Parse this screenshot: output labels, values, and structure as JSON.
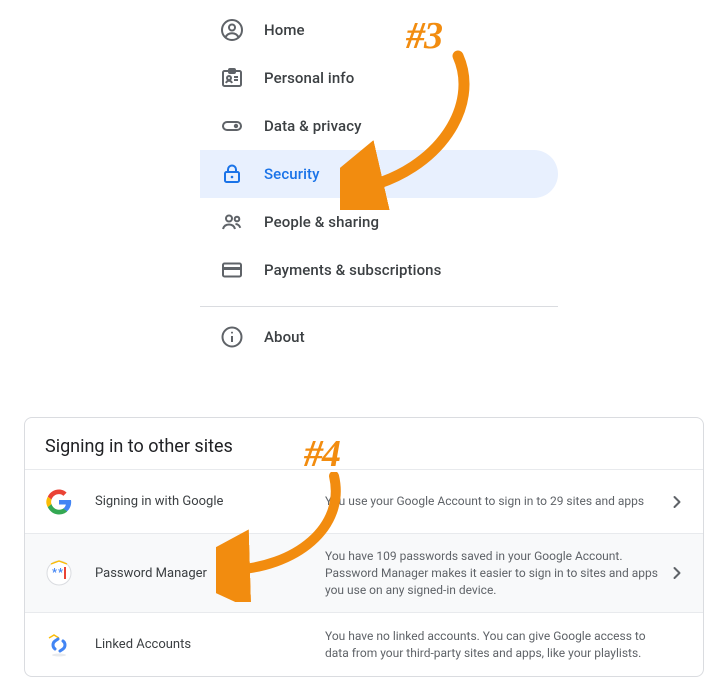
{
  "nav": {
    "items": [
      {
        "id": "home",
        "label": "Home"
      },
      {
        "id": "personal-info",
        "label": "Personal info"
      },
      {
        "id": "data-privacy",
        "label": "Data & privacy"
      },
      {
        "id": "security",
        "label": "Security",
        "active": true
      },
      {
        "id": "people-sharing",
        "label": "People & sharing"
      },
      {
        "id": "payments-subscriptions",
        "label": "Payments & subscriptions"
      }
    ],
    "about": {
      "label": "About"
    }
  },
  "card": {
    "title": "Signing in to other sites",
    "rows": [
      {
        "id": "signing-in-google",
        "label": "Signing in with Google",
        "desc": "You use your Google Account to sign in to 29 sites and apps",
        "chevron": true
      },
      {
        "id": "password-manager",
        "label": "Password Manager",
        "desc": "You have 109 passwords saved in your Google Account. Password Manager makes it easier to sign in to sites and apps you use on any signed-in device.",
        "chevron": true,
        "highlight": true
      },
      {
        "id": "linked-accounts",
        "label": "Linked Accounts",
        "desc": "You have no linked accounts. You can give Google access to data from your third-party sites and apps, like your playlists.",
        "chevron": false
      }
    ]
  },
  "annotations": {
    "step3": "#3",
    "step4": "#4"
  }
}
